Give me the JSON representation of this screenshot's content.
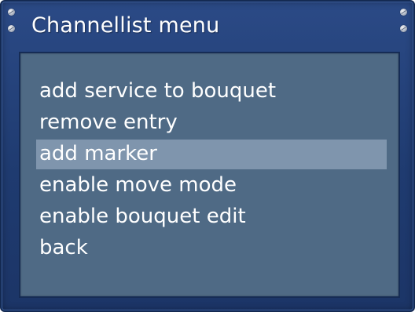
{
  "window": {
    "title": "Channellist menu"
  },
  "menu": {
    "items": [
      {
        "label": "add service to bouquet",
        "selected": false
      },
      {
        "label": "remove entry",
        "selected": false
      },
      {
        "label": "add marker",
        "selected": true
      },
      {
        "label": "enable move mode",
        "selected": false
      },
      {
        "label": "enable bouquet edit",
        "selected": false
      },
      {
        "label": "back",
        "selected": false
      }
    ]
  },
  "colors": {
    "frame": "#213f75",
    "panel": "#4f6a85",
    "selection": "#7f95ad",
    "text": "#ffffff"
  },
  "icons": [
    "screw-icon"
  ]
}
